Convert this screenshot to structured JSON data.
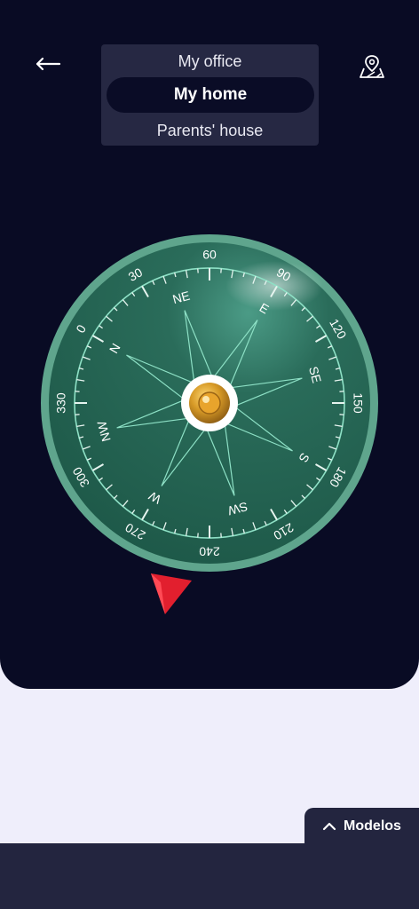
{
  "header": {
    "back_icon": "arrow-left-icon",
    "map_icon": "map-pin-icon"
  },
  "locations": {
    "items": [
      "My office",
      "My home",
      "Parents' house"
    ],
    "selected": "My home"
  },
  "compass": {
    "degree_labels": [
      "0",
      "30",
      "60",
      "90",
      "120",
      "150",
      "180",
      "210",
      "240",
      "270",
      "300",
      "330"
    ],
    "direction_labels": [
      "N",
      "NE",
      "E",
      "SE",
      "S",
      "SW",
      "W",
      "NW"
    ],
    "rotation_deg": -60,
    "colors": {
      "ring": "#5fa58d",
      "face": "#215d4c",
      "lines": "#8de0c5",
      "pointer": "#e21f2e",
      "knob": "#d79a27"
    }
  },
  "models_tab": {
    "label": "Modelos",
    "icon": "chevron-up-icon"
  }
}
